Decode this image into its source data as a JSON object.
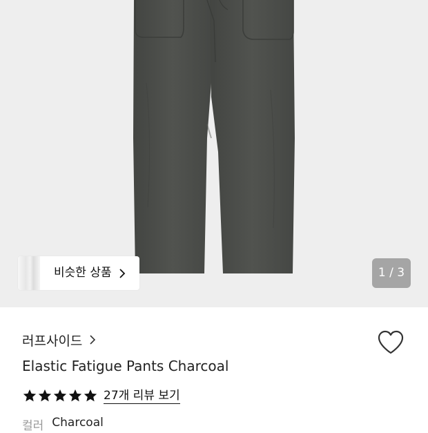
{
  "hero": {
    "similar_label": "비슷한 상품",
    "pager": "1 / 3"
  },
  "product": {
    "brand": "러프사이드",
    "title": "Elastic Fatigue Pants Charcoal",
    "rating_stars": 5,
    "review_link": "27개 리뷰 보기",
    "color_label": "컬러",
    "color_value": "Charcoal"
  },
  "colors": {
    "pants": "#4d4f4c",
    "hero_bg": "#eeeeee",
    "pager_bg": "#7d7d7d"
  },
  "icons": [
    "chevron-right-icon",
    "heart-outline-icon",
    "star-icon"
  ]
}
